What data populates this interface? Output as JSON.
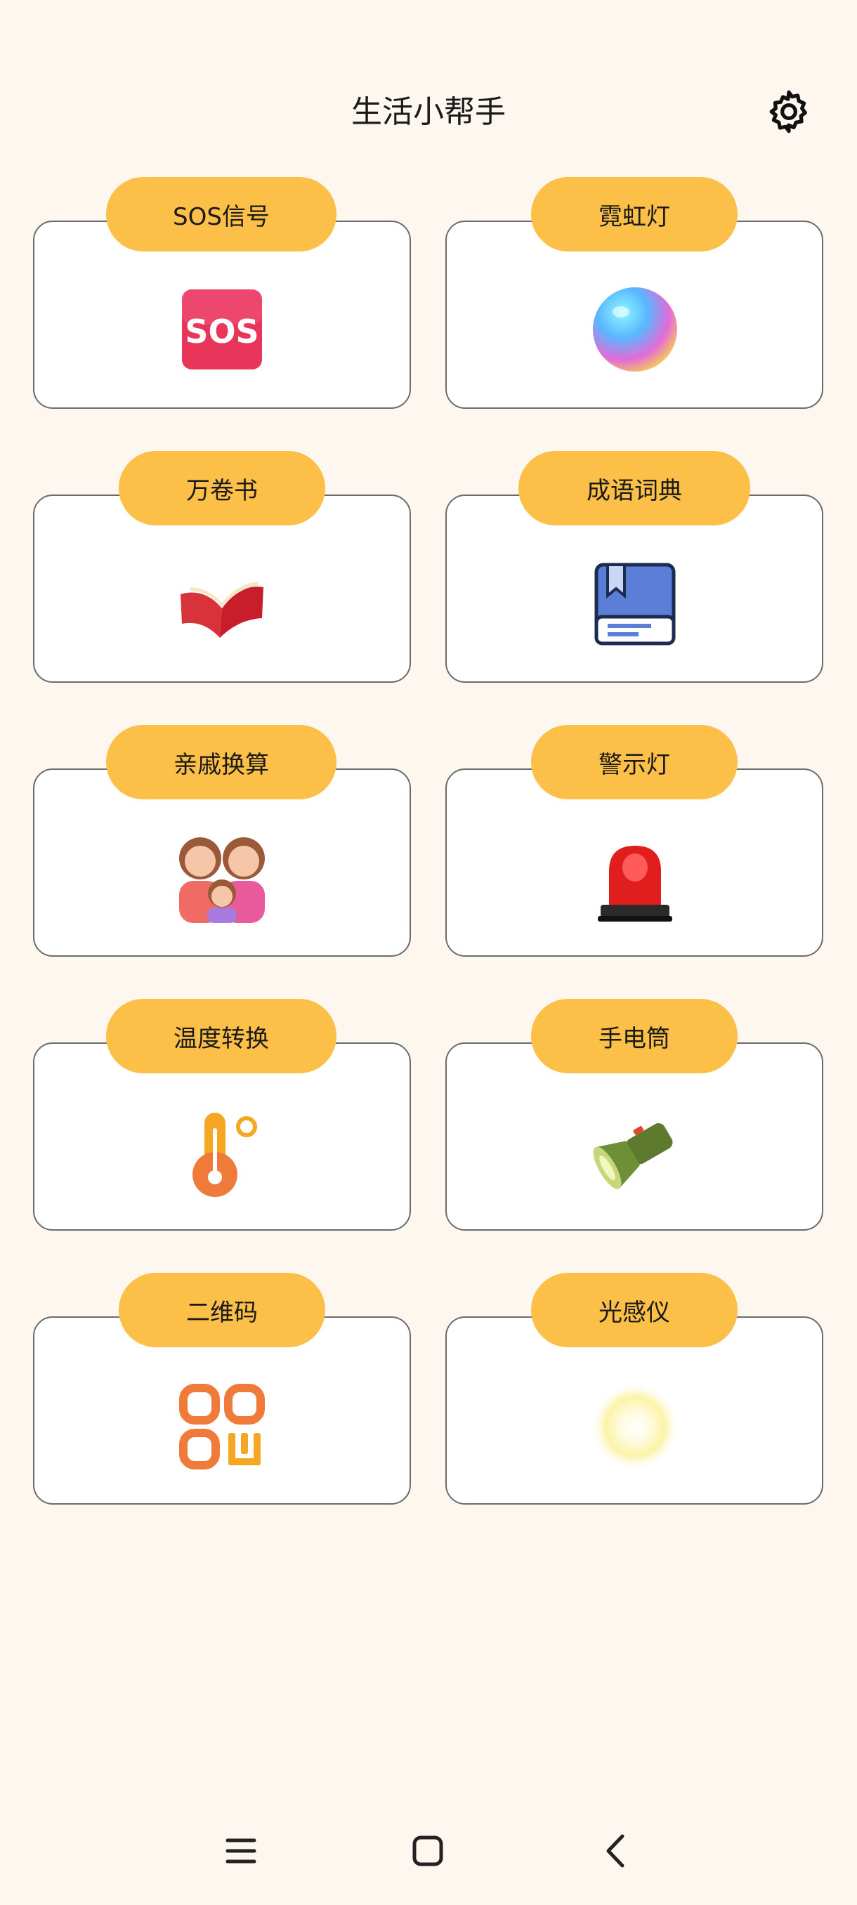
{
  "header": {
    "title": "生活小帮手",
    "settings_icon": "gear-icon"
  },
  "tools": [
    {
      "label": "SOS信号",
      "icon": "sos-icon"
    },
    {
      "label": "霓虹灯",
      "icon": "neon-orb-icon"
    },
    {
      "label": "万卷书",
      "icon": "open-book-icon"
    },
    {
      "label": "成语词典",
      "icon": "dictionary-book-icon"
    },
    {
      "label": "亲戚换算",
      "icon": "family-icon"
    },
    {
      "label": "警示灯",
      "icon": "siren-light-icon"
    },
    {
      "label": "温度转换",
      "icon": "thermometer-icon"
    },
    {
      "label": "手电筒",
      "icon": "flashlight-icon"
    },
    {
      "label": "二维码",
      "icon": "qr-code-icon"
    },
    {
      "label": "光感仪",
      "icon": "light-sensor-icon"
    }
  ],
  "nav_bar": {
    "items": [
      "menu-icon",
      "home-icon",
      "back-icon"
    ]
  },
  "colors": {
    "background": "#FDF7F0",
    "pill": "#FCBF47",
    "card_border": "#6b6b6b"
  }
}
